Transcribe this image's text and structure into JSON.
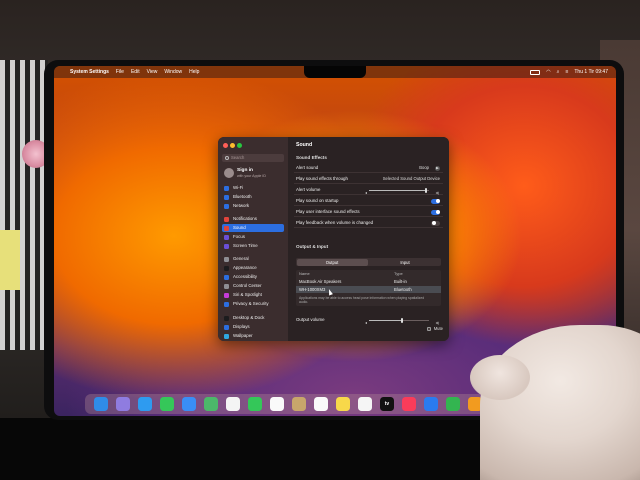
{
  "menubar": {
    "app_name": "System Settings",
    "menus": [
      "File",
      "Edit",
      "View",
      "Window",
      "Help"
    ],
    "clock": "Thu 1 Tir  09:47"
  },
  "sidebar": {
    "search_placeholder": "Search",
    "signin_title": "Sign in",
    "signin_subtitle": "with your Apple ID",
    "items": [
      {
        "label": "Wi-Fi",
        "icon": "wifi-icon",
        "color": "#2c6ee0"
      },
      {
        "label": "Bluetooth",
        "icon": "bluetooth-icon",
        "color": "#2c6ee0"
      },
      {
        "label": "Network",
        "icon": "network-icon",
        "color": "#2c6ee0"
      },
      {
        "label": "Notifications",
        "icon": "bell-icon",
        "color": "#e0443c"
      },
      {
        "label": "Sound",
        "icon": "speaker-icon",
        "color": "#e0443c"
      },
      {
        "label": "Focus",
        "icon": "moon-icon",
        "color": "#6a4fd6"
      },
      {
        "label": "Screen Time",
        "icon": "hourglass-icon",
        "color": "#6a4fd6"
      },
      {
        "label": "General",
        "icon": "gear-icon",
        "color": "#8e8e93"
      },
      {
        "label": "Appearance",
        "icon": "appearance-icon",
        "color": "#1c1c1e"
      },
      {
        "label": "Accessibility",
        "icon": "accessibility-icon",
        "color": "#2c6ee0"
      },
      {
        "label": "Control Center",
        "icon": "control-center-icon",
        "color": "#8e8e93"
      },
      {
        "label": "Siri & Spotlight",
        "icon": "siri-icon",
        "color": "#c53bd8"
      },
      {
        "label": "Privacy & Security",
        "icon": "hand-icon",
        "color": "#2c6ee0"
      },
      {
        "label": "Desktop & Dock",
        "icon": "dock-icon",
        "color": "#1c1c1e"
      },
      {
        "label": "Displays",
        "icon": "display-icon",
        "color": "#2c6ee0"
      },
      {
        "label": "Wallpaper",
        "icon": "wallpaper-icon",
        "color": "#2fa8e0"
      }
    ],
    "selected": "Sound"
  },
  "main": {
    "title": "Sound",
    "sound_effects_header": "Sound Effects",
    "alert_sound_label": "Alert sound",
    "alert_sound_value": "Boop",
    "play_through_label": "Play sound effects through",
    "play_through_value": "Selected Sound Output Device",
    "alert_volume_label": "Alert volume",
    "alert_volume_level": 0.95,
    "startup_label": "Play sound on startup",
    "startup_on": true,
    "ui_sounds_label": "Play user interface sound effects",
    "ui_sounds_on": true,
    "feedback_label": "Play feedback when volume is changed",
    "feedback_on": false,
    "output_input_header": "Output & Input",
    "tabs": [
      "Output",
      "Input"
    ],
    "active_tab": "Output",
    "table_headers": [
      "Name",
      "Type"
    ],
    "devices": [
      {
        "name": "MacBook Air Speakers",
        "type": "Built-in"
      },
      {
        "name": "WH-1000XM3",
        "type": "Bluetooth"
      }
    ],
    "note": "Applications may be able to access head pose information when playing spatialized audio.",
    "output_volume_label": "Output volume",
    "output_volume_level": 0.55,
    "mute_label": "Mute",
    "mute_checked": false
  },
  "dock": {
    "apps": [
      {
        "name": "finder-icon",
        "color": "#2f8ce8",
        "glyph": ""
      },
      {
        "name": "launchpad-icon",
        "color": "#8f7ce0",
        "glyph": ""
      },
      {
        "name": "safari-icon",
        "color": "#2e9bf0",
        "glyph": ""
      },
      {
        "name": "messages-icon",
        "color": "#35c759",
        "glyph": ""
      },
      {
        "name": "mail-icon",
        "color": "#3a8ef6",
        "glyph": ""
      },
      {
        "name": "maps-icon",
        "color": "#4cb86a",
        "glyph": ""
      },
      {
        "name": "photos-icon",
        "color": "#f4f4f4",
        "glyph": ""
      },
      {
        "name": "facetime-icon",
        "color": "#34c759",
        "glyph": ""
      },
      {
        "name": "calendar-icon",
        "color": "#fafafa",
        "glyph": ""
      },
      {
        "name": "contacts-icon",
        "color": "#c8a66b",
        "glyph": ""
      },
      {
        "name": "reminders-icon",
        "color": "#fafafa",
        "glyph": ""
      },
      {
        "name": "notes-icon",
        "color": "#f7d84a",
        "glyph": ""
      },
      {
        "name": "freeform-icon",
        "color": "#f5f5f5",
        "glyph": ""
      },
      {
        "name": "apple-tv-icon",
        "color": "#111111",
        "glyph": "tv"
      },
      {
        "name": "music-icon",
        "color": "#fa3c5a",
        "glyph": ""
      },
      {
        "name": "keynote-icon",
        "color": "#2a7bf0",
        "glyph": ""
      },
      {
        "name": "numbers-icon",
        "color": "#33b550",
        "glyph": ""
      },
      {
        "name": "pages-icon",
        "color": "#f29b1f",
        "glyph": ""
      },
      {
        "name": "app-store-icon",
        "color": "#1f8cf0",
        "glyph": ""
      }
    ]
  }
}
